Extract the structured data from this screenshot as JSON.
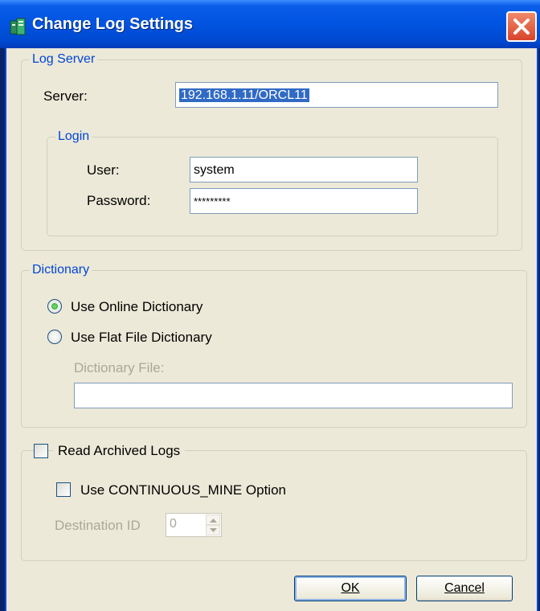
{
  "window": {
    "title": "Change Log Settings",
    "icon": "database-icon",
    "close_icon": "close-icon"
  },
  "log_server": {
    "legend": "Log Server",
    "server_label": "Server:",
    "server_value": "192.168.1.11/ORCL11",
    "login": {
      "legend": "Login",
      "user_label": "User:",
      "user_value": "system",
      "password_label": "Password:",
      "password_value": "*********"
    }
  },
  "dictionary": {
    "legend": "Dictionary",
    "option_online": "Use Online Dictionary",
    "option_flat_file": "Use Flat File Dictionary",
    "selected": "online",
    "file_label": "Dictionary File:",
    "file_value": ""
  },
  "archived_logs": {
    "read_archived_label": "Read Archived Logs",
    "read_archived_checked": false,
    "continuous_mine_label": "Use CONTINUOUS_MINE Option",
    "continuous_mine_checked": false,
    "destination_id_label": "Destination ID",
    "destination_id_value": "0"
  },
  "buttons": {
    "ok_label": "OK",
    "cancel_label": "Cancel"
  },
  "colors": {
    "title_bar": "#0053e0",
    "dialog_bg": "#ece9d8",
    "group_legend": "#0046d5",
    "selection": "#316ac5",
    "radio_dot": "#21a121",
    "disabled_text": "#aca899"
  }
}
